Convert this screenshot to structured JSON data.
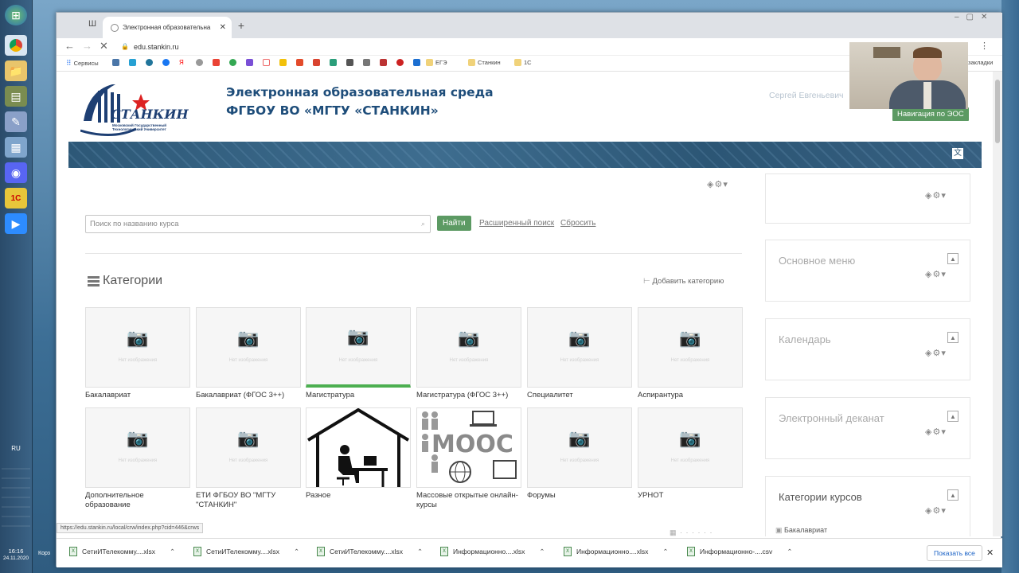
{
  "taskbar": {
    "lang": "RU",
    "time": "16:16",
    "date": "24.11.2020",
    "bottom_label": "Корз"
  },
  "browser": {
    "tab_title": "Электронная образовательна",
    "new_tab": "+",
    "url": "edu.stankin.ru",
    "bookmarks": [
      {
        "label": "Сервисы"
      },
      {
        "label": "ЕГЭ"
      },
      {
        "label": "Станкин"
      },
      {
        "label": "1С"
      }
    ],
    "bookmarks_right": "закладки",
    "status_url": "https://edu.stankin.ru/local/crw/index.php?cid=446&crws",
    "downloads": [
      {
        "name": "СетиИТелекомму....xlsx"
      },
      {
        "name": "СетиИТелекомму....xlsx"
      },
      {
        "name": "СетиИТелекомму....xlsx"
      },
      {
        "name": "Информационно....xlsx"
      },
      {
        "name": "Информационно....xlsx"
      },
      {
        "name": "Информационно-....csv"
      }
    ],
    "show_all": "Показать все"
  },
  "site": {
    "logo_text": "СТАНКИН",
    "logo_sub": "Московский Государственный Технологический Университет",
    "title_line1": "Электронная образовательная среда",
    "title_line2": "ФГБОУ ВО «МГТУ «СТАНКИН»",
    "user": "Сергей Евгеньевич",
    "nav_button": "Навигация по ЭОС"
  },
  "search": {
    "placeholder": "Поиск по названию курса",
    "find": "Найти",
    "advanced": "Расширенный поиск",
    "reset": "Сбросить"
  },
  "categories": {
    "heading": "Категории",
    "add": "Добавить категорию",
    "no_image": "Нет изображения",
    "row1": [
      "Бакалавриат",
      "Бакалавриат (ФГОС 3++)",
      "Магистратура",
      "Магистратура (ФГОС 3++)",
      "Специалитет",
      "Аспирантура"
    ],
    "row2": [
      "Дополнительное образование",
      "ЕТИ ФГБОУ ВО \"МГТУ \"СТАНКИН\"",
      "Разное",
      "Массовые открытые онлайн-курсы",
      "Форумы",
      "УРНОТ"
    ],
    "mooc_text": "MOOC"
  },
  "sidebar": {
    "blocks": [
      "Основное меню",
      "Календарь",
      "Электронный деканат",
      "Категории курсов"
    ],
    "first_item": "Бакалавриат"
  }
}
